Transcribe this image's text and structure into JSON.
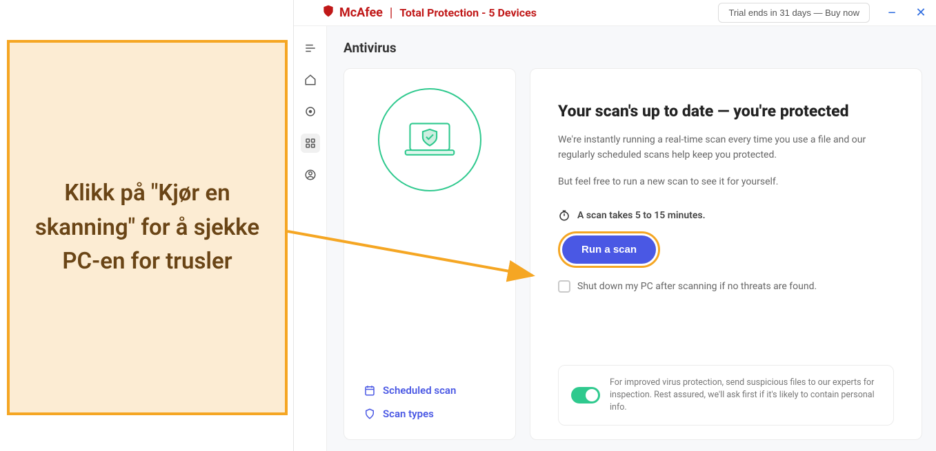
{
  "titlebar": {
    "brand": "McAfee",
    "product": "Total Protection - 5 Devices",
    "trial_button": "Trial ends in 31 days — Buy now"
  },
  "nav": {
    "menu": "menu",
    "home": "home",
    "protection": "protection",
    "apps": "apps",
    "account": "account"
  },
  "page": {
    "title": "Antivirus"
  },
  "left_panel": {
    "scheduled_scan": "Scheduled scan",
    "scan_types": "Scan types"
  },
  "right_panel": {
    "headline": "Your scan's up to date — you're protected",
    "body1": "We're instantly running a real-time scan every time you use a file and our regularly scheduled scans help keep you protected.",
    "body2": "But feel free to run a new scan to see it for yourself.",
    "scan_time": "A scan takes 5 to 15 minutes.",
    "run_button": "Run a scan",
    "shutdown_chk": "Shut down my PC after scanning if no threats are found.",
    "footer_note": "For improved virus protection, send suspicious files to our experts for inspection. Rest assured, we'll ask first if it's likely to contain personal info."
  },
  "annotation": {
    "callout": "Klikk på \"Kjør en skanning\" for å sjekke PC-en for trusler"
  }
}
